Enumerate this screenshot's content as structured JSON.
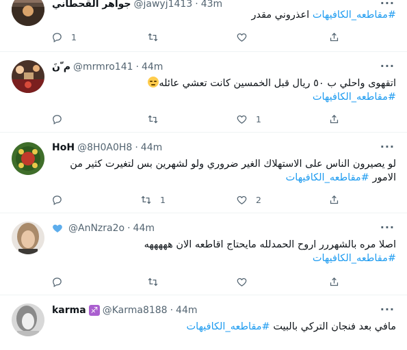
{
  "tweets": [
    {
      "name": "جواهر القحطاني",
      "handle": "@jawyj1413",
      "time": "43m",
      "text": "اعذروني مقدر",
      "hashtag": "#مقاطعه_الكافيهات",
      "replies": "1",
      "retweets": "",
      "likes": ""
    },
    {
      "name": "م ّنَ",
      "handle": "@mrmro141",
      "time": "44m",
      "text": "اتقهوى واحلي ب ٥٠ ريال قبل الخمسين كانت تعشي عائله",
      "hashtag": "#مقاطعه_الكافيهات",
      "replies": "",
      "retweets": "",
      "likes": "1"
    },
    {
      "name": "HoH",
      "handle": "@8H0A0H8",
      "time": "44m",
      "text": "لو يصيرون الناس على الاستهلاك الغير ضروري ولو لشهرين بس لتغيرت كثير من الامور",
      "hashtag": "#مقاطعه_الكافيهات",
      "replies": "",
      "retweets": "1",
      "likes": "2"
    },
    {
      "name": "",
      "handle": "@AnNzra2o",
      "time": "44m",
      "text": "اصلا مره بالشهررر اروح الحمدلله مايحتاج اقاطعه  الان هههههه",
      "hashtag": "#مقاطعه_الكافيهات",
      "replies": "",
      "retweets": "",
      "likes": ""
    },
    {
      "name": "karma",
      "handle": "@Karma8188",
      "time": "44m",
      "text": "مافي بعد فنجان التركي بالبيت",
      "hashtag": "#مقاطعه_الكافيهات",
      "replies": "",
      "retweets": "",
      "likes": ""
    }
  ],
  "separator": "·",
  "more_label": "···",
  "icons": {
    "reply": "reply-icon",
    "retweet": "retweet-icon",
    "like": "like-icon",
    "share": "share-icon"
  },
  "colors": {
    "hashtag": "#1d9bf0",
    "secondary_text": "#536471",
    "divider": "#eff3f4"
  }
}
